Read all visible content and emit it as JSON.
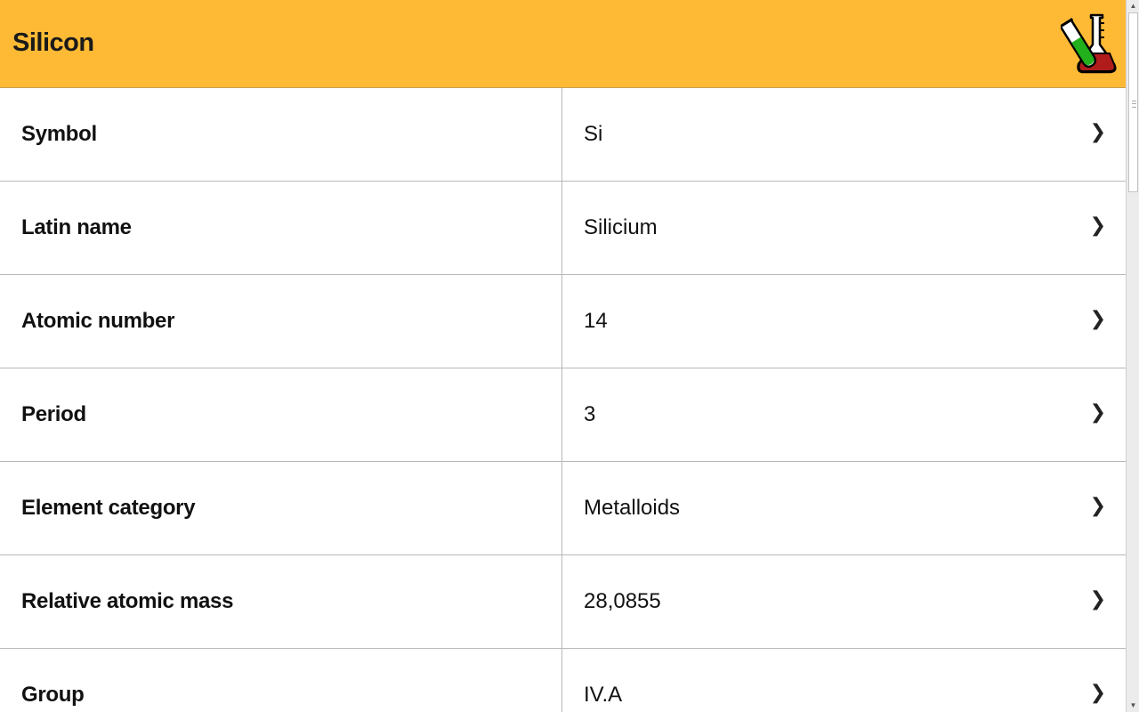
{
  "header": {
    "title": "Silicon",
    "icon": "chemistry-flask-icon",
    "background_color": "#ffba35"
  },
  "properties": [
    {
      "label": "Symbol",
      "value": "Si"
    },
    {
      "label": "Latin name",
      "value": "Silicium"
    },
    {
      "label": "Atomic number",
      "value": "14"
    },
    {
      "label": "Period",
      "value": "3"
    },
    {
      "label": "Element category",
      "value": "Metalloids"
    },
    {
      "label": "Relative atomic mass",
      "value": "28,0855"
    },
    {
      "label": "Group",
      "value": "IV.A"
    }
  ],
  "row_chevron": "❯",
  "scrollbar": {
    "up_arrow": "▲",
    "down_arrow": "▼"
  }
}
